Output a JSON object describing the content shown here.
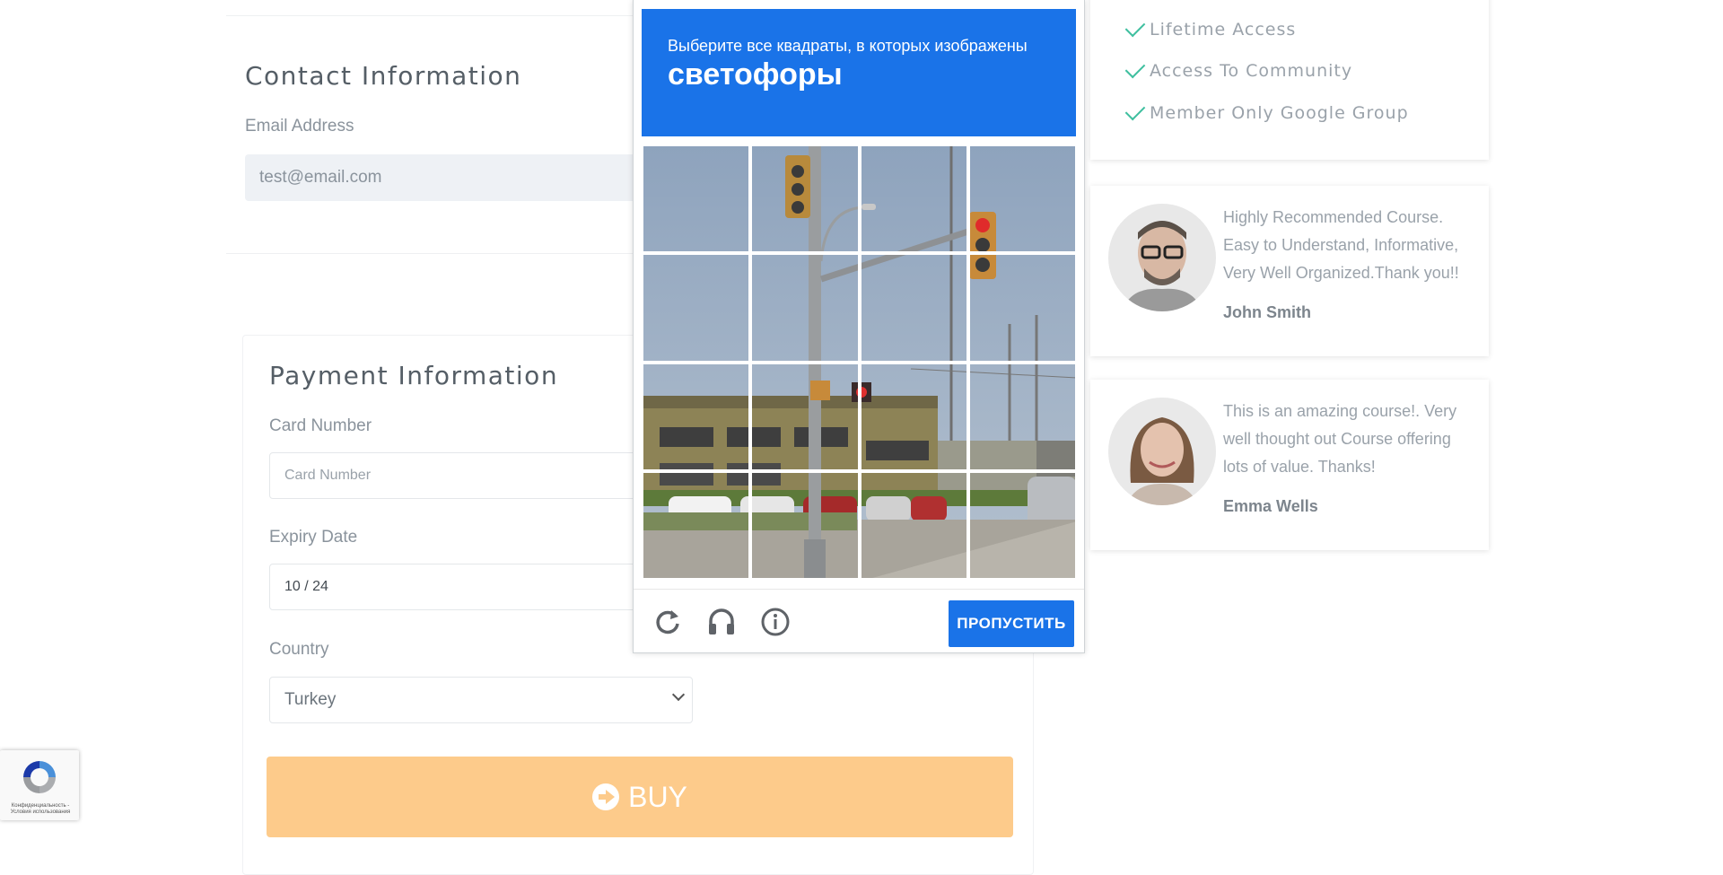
{
  "contact": {
    "title": "Contact Information",
    "email_label": "Email Address",
    "email_value": "test@email.com"
  },
  "payment": {
    "title": "Payment Information",
    "card_label": "Card Number",
    "card_placeholder": "Card Number",
    "expiry_label": "Expiry Date",
    "expiry_value": "10 / 24",
    "country_label": "Country",
    "country_value": "Turkey",
    "buy_label": "BUY"
  },
  "features": [
    {
      "label": "Lifetime Access",
      "icon": "check-icon"
    },
    {
      "label": "Access To Community",
      "icon": "check-icon"
    },
    {
      "label": "Member Only Google Group",
      "icon": "check-icon"
    }
  ],
  "testimonials": [
    {
      "text": "Highly Recommended Course. Easy to Understand, Informative, Very Well Organized.Thank you!!",
      "name": "John Smith"
    },
    {
      "text": "This is an amazing course!. Very well thought out Course offering lots of value. Thanks!",
      "name": "Emma Wells"
    }
  ],
  "captcha": {
    "instruction": "Выберите все квадраты, в которых изображены",
    "target": "светофоры",
    "skip_label": "ПРОПУСТИТЬ",
    "grid_size": 4,
    "icons": [
      "reload-icon",
      "audio-icon",
      "info-icon"
    ]
  },
  "badge": {
    "text": "Конфиденциальность - Условия использования"
  },
  "colors": {
    "captcha_blue": "#1a73e8",
    "buy_orange": "#fdcb8b",
    "check_green": "#3fbf9f"
  }
}
